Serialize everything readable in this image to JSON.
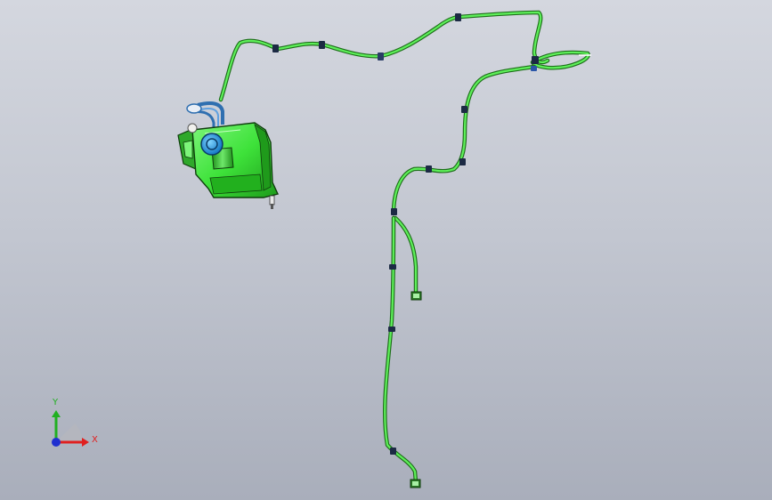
{
  "viewport": {
    "background_top": "#d4d7df",
    "background_bottom": "#a9aebb"
  },
  "model": {
    "hose_color": "#3ed13a",
    "hose_outline": "#1e6e1a",
    "clip_color": "#1c2a44",
    "tank_color": "#3ee23a",
    "cap_color": "#1fa4e6",
    "bracket_color": "#2f6fb0"
  },
  "triad": {
    "x_label": "X",
    "y_label": "Y",
    "x_color": "#e02020",
    "y_color": "#20b020",
    "origin_color": "#2030d0"
  }
}
